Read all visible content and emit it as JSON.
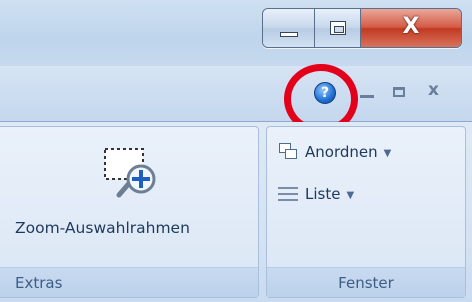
{
  "window": {
    "minimize_icon": "minimize-icon",
    "maximize_icon": "maximize-icon",
    "close_label": "X"
  },
  "tabrow": {
    "help_label": "?",
    "mdi_close_label": "x"
  },
  "ribbon": {
    "groups": [
      {
        "label": "Extras",
        "buttons": [
          {
            "label": "Zoom-Auswahlrahmen",
            "icon": "zoom-selection-icon"
          }
        ]
      },
      {
        "label": "Fenster",
        "buttons": [
          {
            "label": "Anordnen",
            "icon": "arrange-windows-icon",
            "has_dropdown": true
          },
          {
            "label": "Liste",
            "icon": "list-icon",
            "has_dropdown": true
          }
        ]
      }
    ]
  },
  "colors": {
    "highlight_circle": "#e3001b",
    "close_button": "#c23a22",
    "help_icon": "#1f6fd1"
  }
}
